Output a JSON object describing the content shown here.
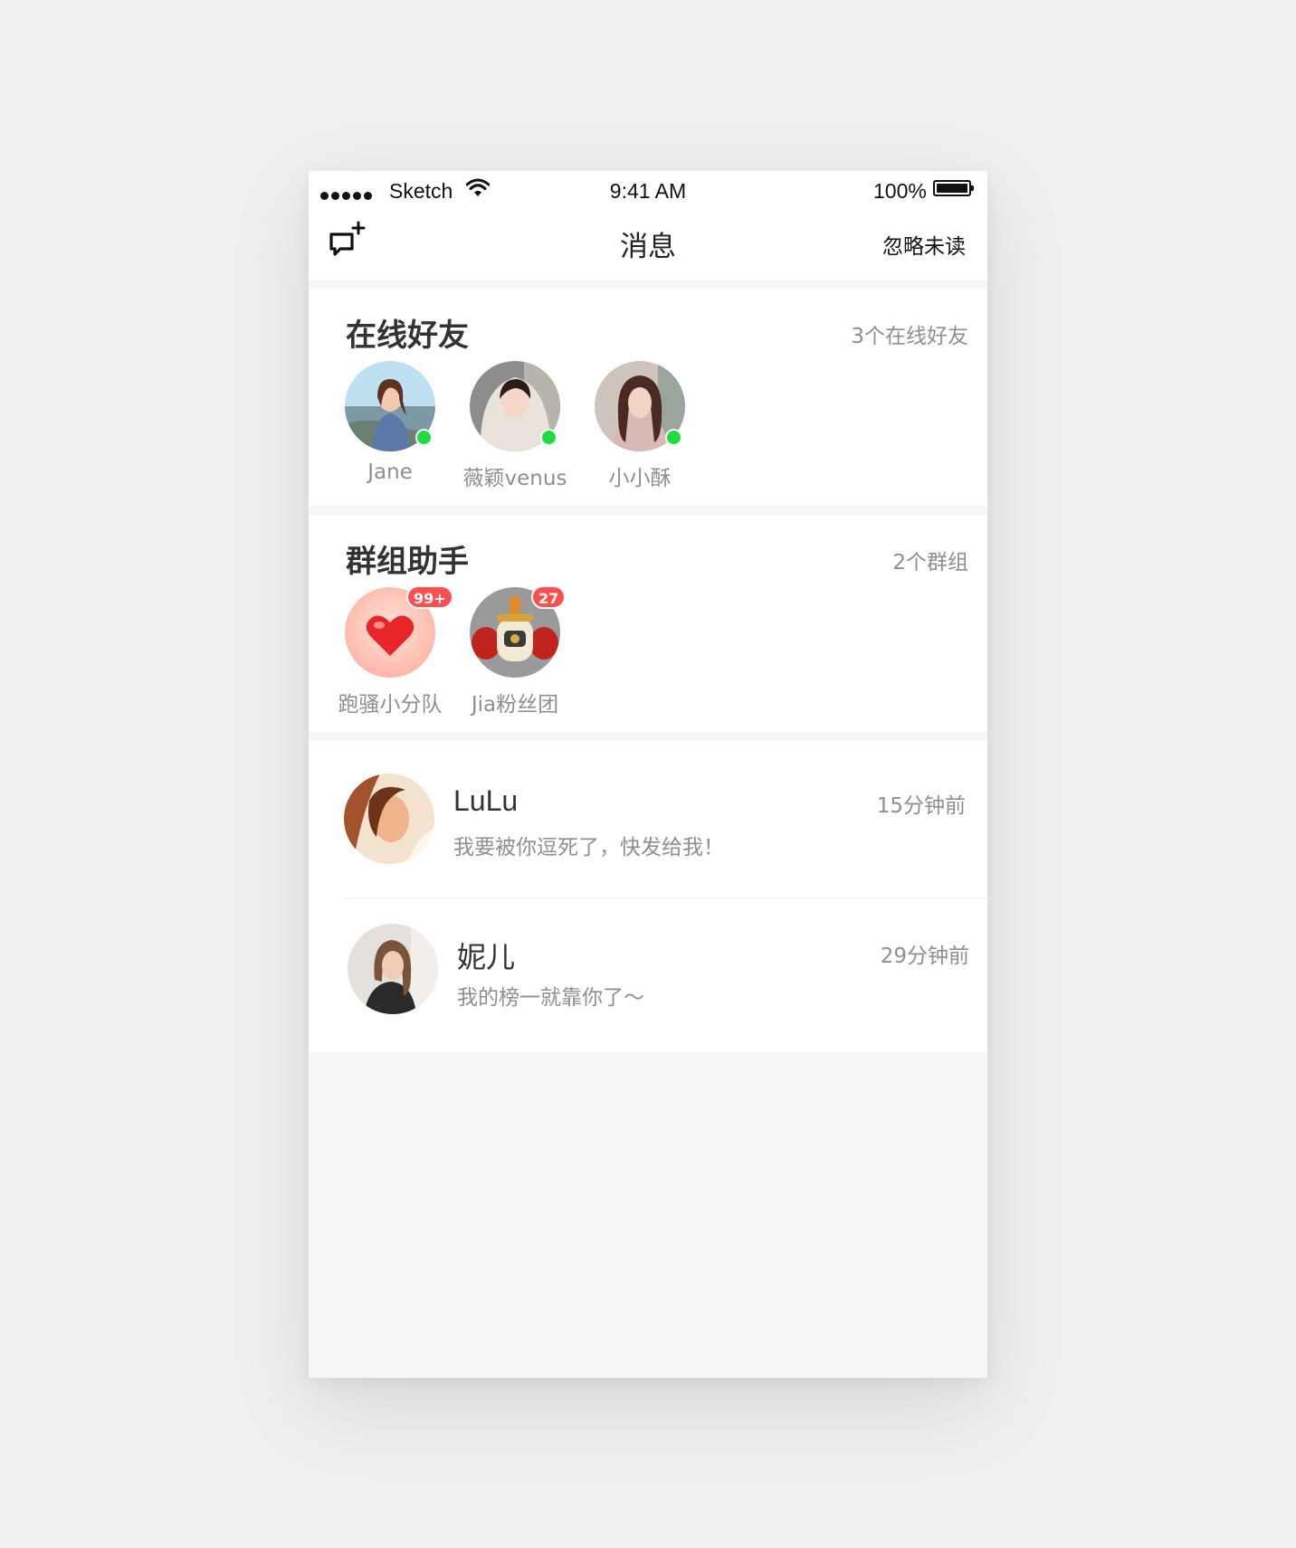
{
  "status_bar": {
    "carrier": "Sketch",
    "time": "9:41 AM",
    "battery": "100%"
  },
  "nav": {
    "title": "消息",
    "right_action": "忽略未读",
    "left_icon": "new-chat-icon"
  },
  "online_friends": {
    "title": "在线好友",
    "count_label": "3个在线好友",
    "friends": [
      {
        "name": "Jane",
        "online": true
      },
      {
        "name": "薇颖venus",
        "online": true
      },
      {
        "name": "小小酥",
        "online": true
      }
    ]
  },
  "groups": {
    "title": "群组助手",
    "count_label": "2个群组",
    "items": [
      {
        "name": "跑骚小分队",
        "badge": "99+"
      },
      {
        "name": "Jia粉丝团",
        "badge": "27"
      }
    ]
  },
  "chats": [
    {
      "name": "LuLu",
      "preview": "我要被你逗死了，快发给我！",
      "time": "15分钟前"
    },
    {
      "name": "妮儿",
      "preview": "我的榜一就靠你了～",
      "time": "29分钟前"
    }
  ],
  "colors": {
    "online_dot": "#1edb3e",
    "badge": "#ff4f4f",
    "background": "#f5f6f8"
  }
}
